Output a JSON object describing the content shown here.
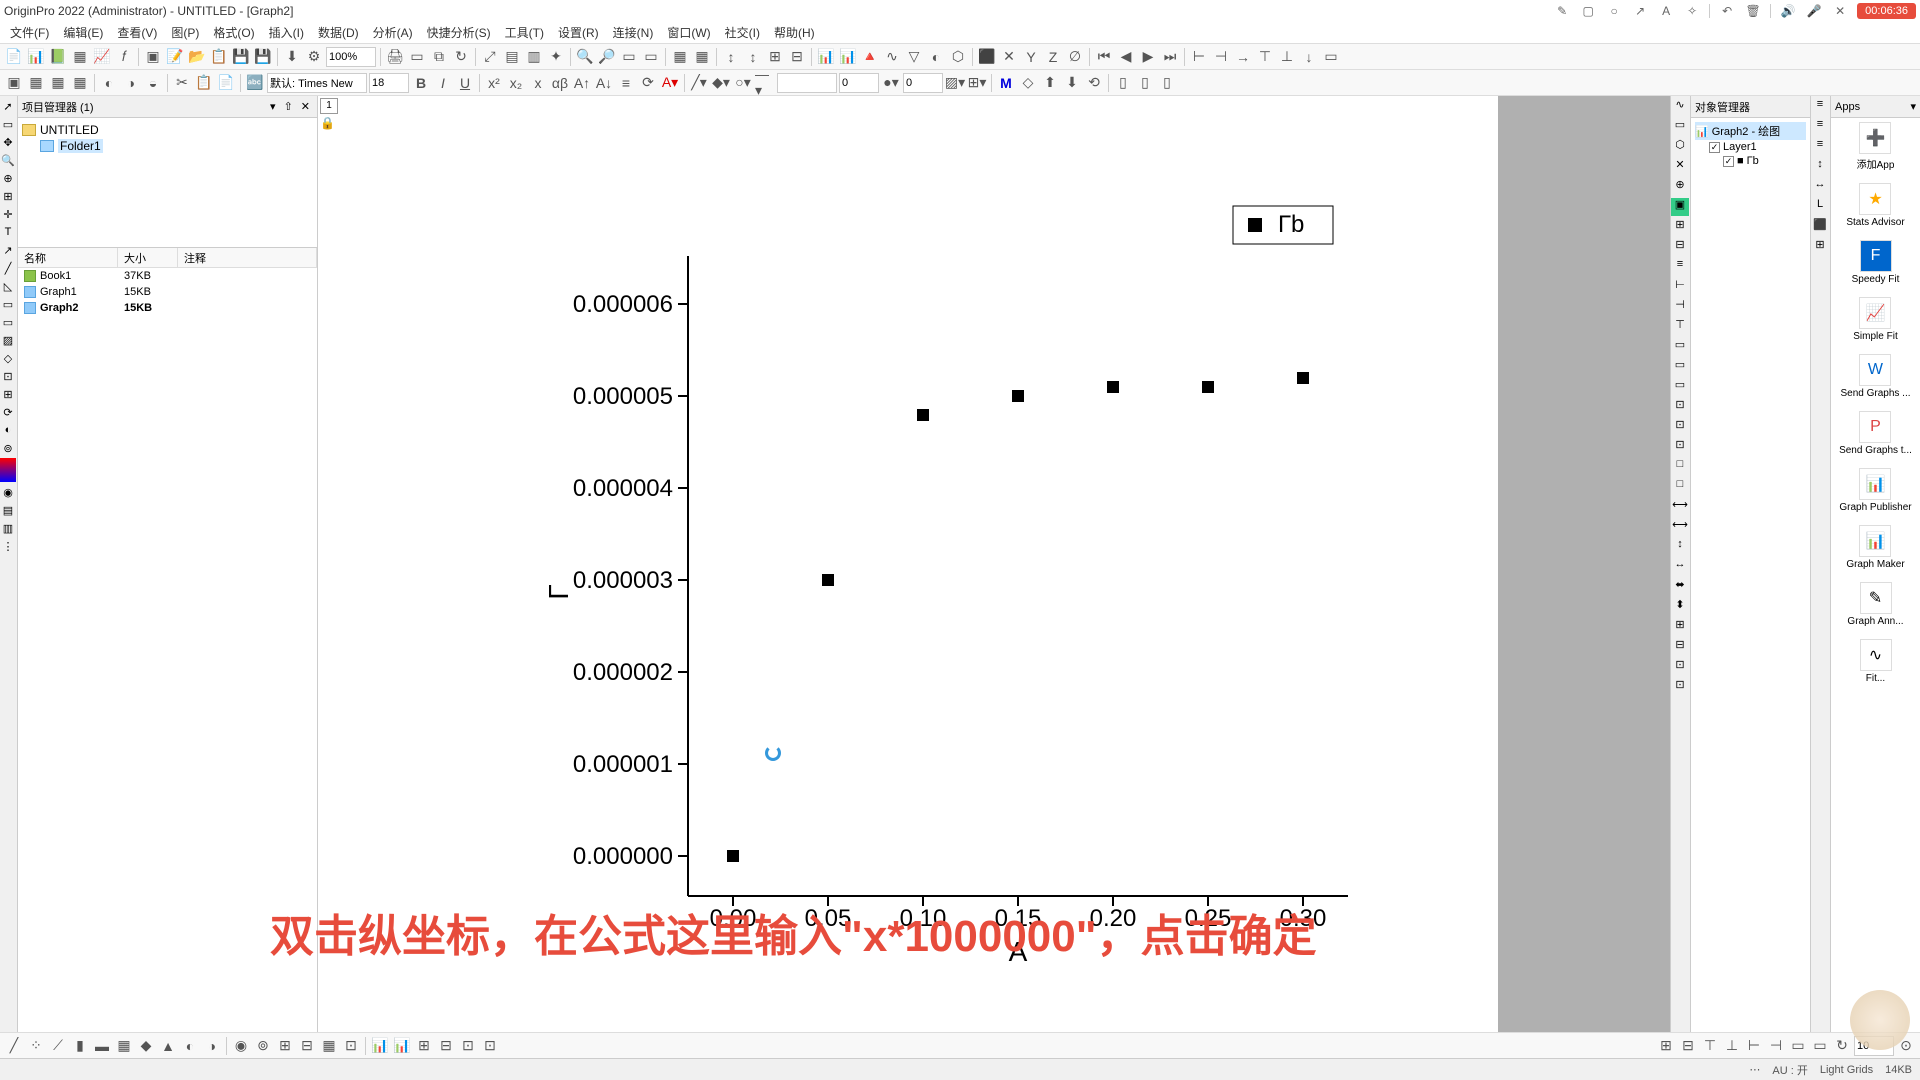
{
  "title": "OriginPro 2022 (Administrator) - UNTITLED - [Graph2]",
  "menus": [
    "文件(F)",
    "编辑(E)",
    "查看(V)",
    "图(P)",
    "格式(O)",
    "插入(I)",
    "数据(D)",
    "分析(A)",
    "快捷分析(S)",
    "工具(T)",
    "设置(R)",
    "连接(N)",
    "窗口(W)",
    "社交(I)",
    "帮助(H)"
  ],
  "titlebar_icons": [
    "pencil-icon",
    "square-icon",
    "circle-icon",
    "arrow-icon",
    "text-icon",
    "highlight-icon",
    "undo-icon",
    "delete-icon",
    "volume-icon",
    "mic-icon",
    "close-icon"
  ],
  "rec_time": "00:06:36",
  "toolbar1": {
    "zoom": "100%",
    "icons": [
      "new-project",
      "new-workbook",
      "new-excel",
      "new-matrix",
      "new-graph",
      "new-layout",
      "new-notes",
      "open",
      "template",
      "save",
      "save-all",
      "print",
      "import-single",
      "import-multi",
      "refresh",
      "sep",
      "add-col",
      "recalc",
      "sep",
      "plot-setup",
      "layer-mgr",
      "sep",
      "rescale",
      "zoom-out",
      "sep",
      "t1",
      "t2",
      "t3",
      "t4",
      "t5",
      "t6",
      "t7",
      "t8",
      "t9",
      "t10",
      "t11",
      "t12",
      "t13",
      "t14",
      "t15",
      "t16",
      "t17",
      "t18",
      "t19",
      "t20",
      "t21",
      "t22",
      "t23",
      "t24",
      "t25"
    ]
  },
  "toolbar2": {
    "font_label": "默认: Times New",
    "font_size": "18",
    "num_a": "0",
    "num_b": "0"
  },
  "project_panel": {
    "title": "项目管理器 (1)",
    "root": "UNTITLED",
    "folder": "Folder1",
    "cols": {
      "name": "名称",
      "size": "大小",
      "note": "注释"
    },
    "files": [
      {
        "name": "Book1",
        "size": "37KB",
        "type": "book"
      },
      {
        "name": "Graph1",
        "size": "15KB",
        "type": "graph"
      },
      {
        "name": "Graph2",
        "size": "15KB",
        "type": "graph",
        "active": true
      }
    ]
  },
  "obj_manager": {
    "title": "对象管理器",
    "graph": "Graph2 - 绘图",
    "layer": "Layer1",
    "series": "Гb"
  },
  "apps": {
    "title": "Apps",
    "items": [
      "添加App",
      "Stats Advisor",
      "Speedy Fit",
      "Simple Fit",
      "Send Graphs ...",
      "Send Graphs t...",
      "Graph Publisher",
      "Graph Maker",
      "Graph Ann...",
      "Fit..."
    ]
  },
  "chart_data": {
    "type": "scatter",
    "legend": "Гb",
    "xlabel": "A",
    "ylabel": "Г",
    "x": [
      0.0,
      0.05,
      0.1,
      0.15,
      0.2,
      0.25,
      0.3
    ],
    "y": [
      0.0,
      3e-06,
      4.8e-06,
      5e-06,
      5.1e-06,
      5.1e-06,
      5.2e-06
    ],
    "xlim": [
      -0.02,
      0.32
    ],
    "ylim": [
      -5e-07,
      6.5e-06
    ],
    "xticks": [
      0.0,
      0.05,
      0.1,
      0.15,
      0.2,
      0.25,
      0.3
    ],
    "yticks": [
      0.0,
      1e-06,
      2e-06,
      3e-06,
      4e-06,
      5e-06,
      6e-06
    ],
    "ytick_labels": [
      "0.000000",
      "0.000001",
      "0.000002",
      "0.000003",
      "0.000004",
      "0.000005",
      "0.000006"
    ]
  },
  "annotation": "双击纵坐标，在公式这里输入\"x*1000000\"，点击确定",
  "bottom_toolbar": {
    "spin": "10"
  },
  "status": {
    "au": "AU : 开",
    "grids": "Light Grids",
    "size": "14KB"
  }
}
